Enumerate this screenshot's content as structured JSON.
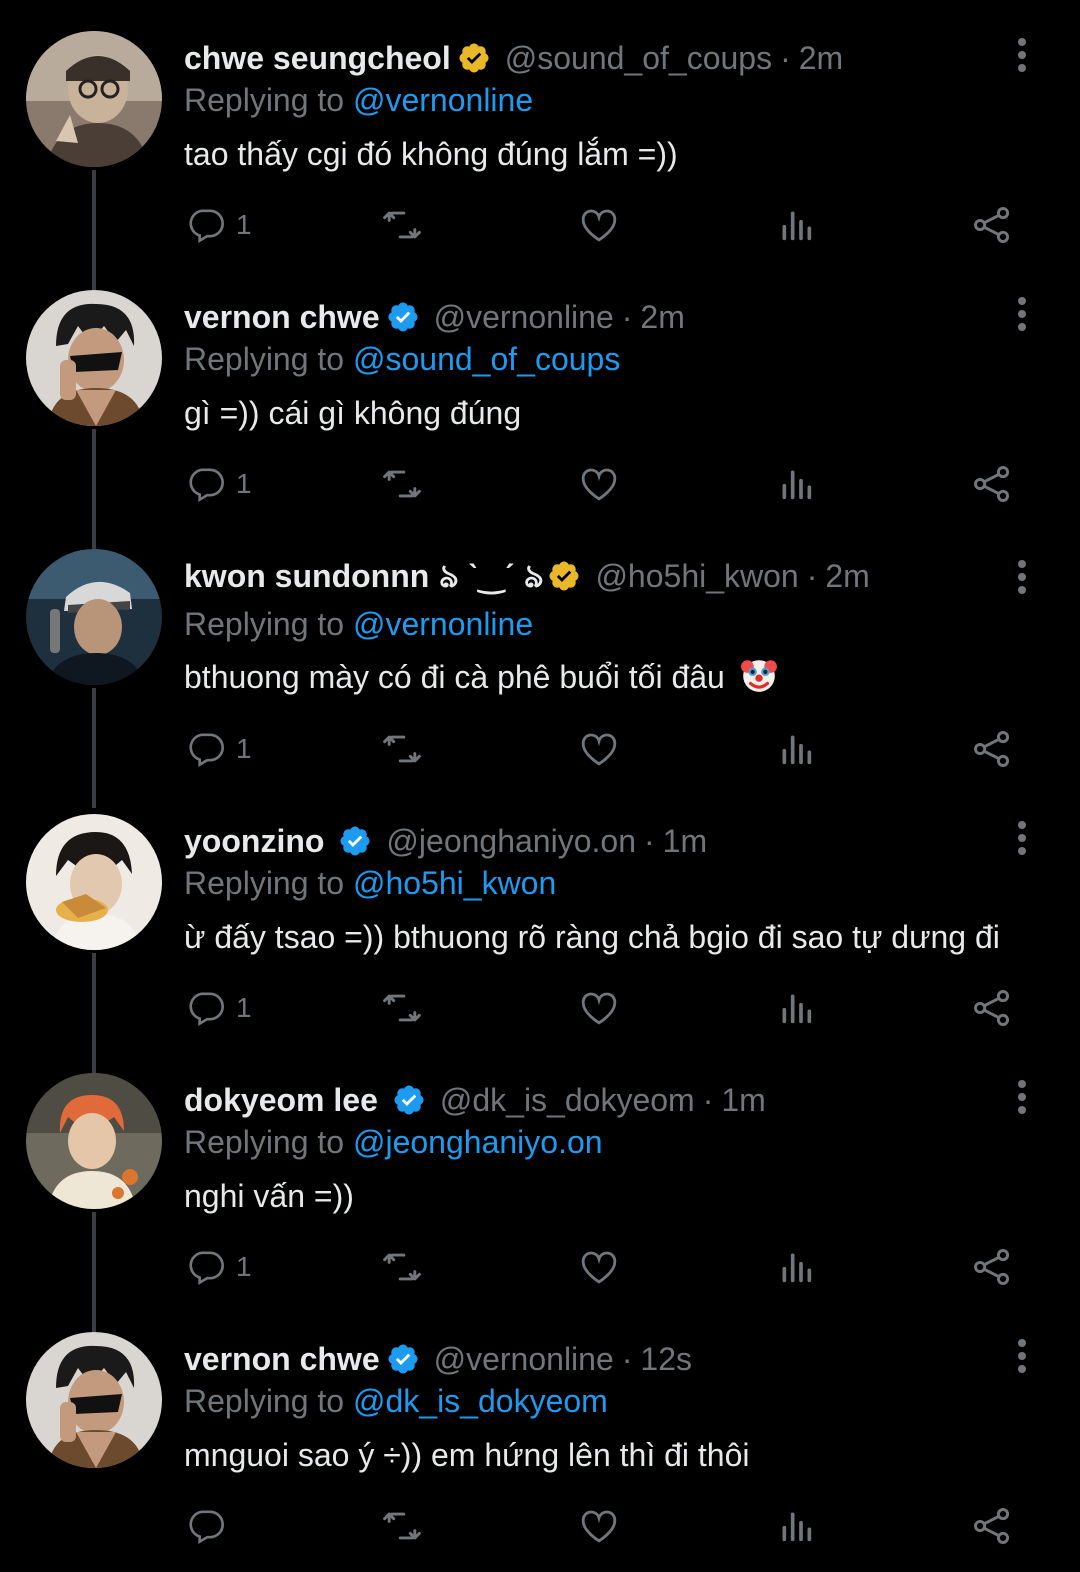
{
  "colors": {
    "background": "#000000",
    "text": "#e7e9ea",
    "muted": "#71767b",
    "link": "#1d9bf0",
    "verified_blue": "#1d9bf0",
    "verified_gold": "#e8b829"
  },
  "tweets": [
    {
      "name": "chwe seungcheol",
      "badge": "gold-verified-icon",
      "handle": "@sound_of_coups",
      "separator": "·",
      "time": "2m",
      "replying_prefix": "Replying to",
      "replying_to": "@vernonline",
      "text": "tao thấy cgi đó không đúng lắm =))",
      "reply_count": "1"
    },
    {
      "name": "vernon chwe",
      "badge": "blue-verified-icon",
      "handle": "@vernonline",
      "separator": "·",
      "time": "2m",
      "replying_prefix": "Replying to",
      "replying_to": "@sound_of_coups",
      "text": "gì =)) cái gì không đúng",
      "reply_count": "1"
    },
    {
      "name": "kwon sundonnn",
      "name_decoration": "ঌ ˋ‿ˊ ঌ",
      "badge": "gold-verified-icon",
      "handle": "@ho5hi_kwon",
      "separator": "·",
      "time": "2m",
      "replying_prefix": "Replying to",
      "replying_to": "@vernonline",
      "text": "bthuong mày có đi cà phê buổi tối đâu",
      "emoji": "clown-face-icon",
      "reply_count": "1"
    },
    {
      "name": "yoonzino",
      "badge": "blue-verified-icon",
      "handle": "@jeonghaniyo.on",
      "separator": "·",
      "time": "1m",
      "replying_prefix": "Replying to",
      "replying_to": "@ho5hi_kwon",
      "text": "ừ đấy tsao =)) bthuong rõ ràng chả bgio đi sao tự dưng đi",
      "reply_count": "1"
    },
    {
      "name": "dokyeom lee",
      "badge": "blue-verified-icon",
      "handle": "@dk_is_dokyeom",
      "separator": "·",
      "time": "1m",
      "replying_prefix": "Replying to",
      "replying_to": "@jeonghaniyo.on",
      "text": "nghi vấn =))",
      "reply_count": "1"
    },
    {
      "name": "vernon chwe",
      "badge": "blue-verified-icon",
      "handle": "@vernonline",
      "separator": "·",
      "time": "12s",
      "replying_prefix": "Replying to",
      "replying_to": "@dk_is_dokyeom",
      "text": "mnguoi sao ý ÷)) em hứng lên thì đi thôi",
      "reply_count": ""
    }
  ],
  "action_icons": [
    "reply-icon",
    "retweet-icon",
    "like-icon",
    "views-icon",
    "share-icon"
  ]
}
